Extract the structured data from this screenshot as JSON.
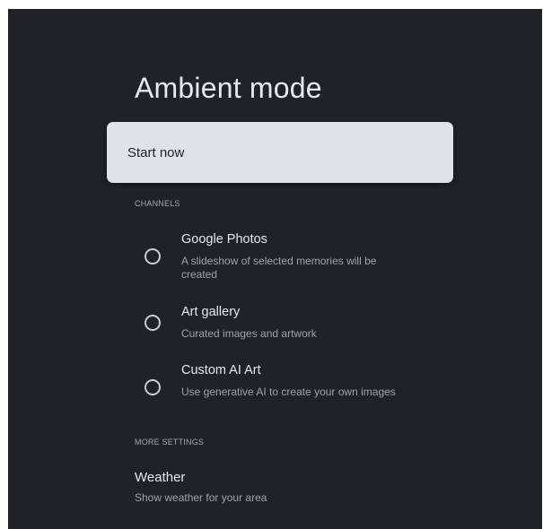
{
  "page": {
    "title": "Ambient mode"
  },
  "start_button": {
    "label": "Start now"
  },
  "channels": {
    "header": "CHANNELS",
    "items": [
      {
        "title": "Google Photos",
        "description": "A slideshow of selected memories will be created",
        "selected": false
      },
      {
        "title": "Art gallery",
        "description": "Curated images and artwork",
        "selected": false
      },
      {
        "title": "Custom AI Art",
        "description": "Use generative AI to create your own images",
        "selected": false
      }
    ]
  },
  "more_settings": {
    "header": "MORE SETTINGS",
    "items": [
      {
        "title": "Weather",
        "description": "Show weather for your area"
      }
    ]
  },
  "colors": {
    "background": "#212226",
    "focused_card": "#e0e2e7",
    "primary_text": "#e6e8ec",
    "secondary_text": "#a0a3a9"
  }
}
